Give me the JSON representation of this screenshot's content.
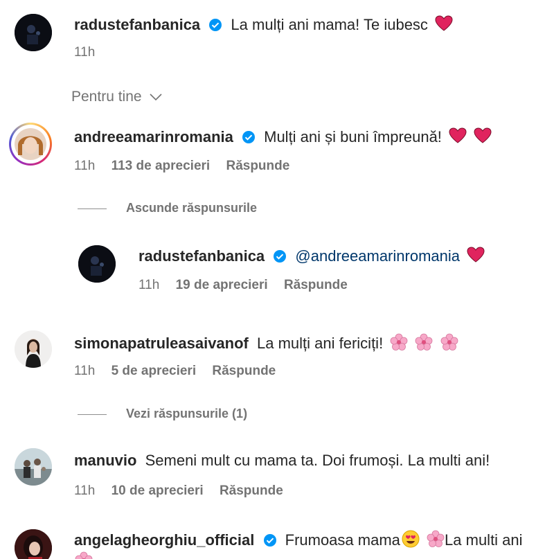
{
  "comments": [
    {
      "username": "radustefanbanica",
      "verified": true,
      "text": "La mulți ani mama! Te iubesc",
      "emoji": [
        "red-heart"
      ],
      "time": "11h"
    }
  ],
  "section_label": "Pentru tine",
  "thread": [
    {
      "username": "andreeamarinromania",
      "verified": true,
      "text": "Mulți ani și buni împreună!",
      "emoji": [
        "red-heart",
        "red-heart"
      ],
      "time": "11h",
      "likes": "113 de aprecieri",
      "reply_label": "Răspunde",
      "toggle": "Ascunde răspunsurile",
      "reply": {
        "username": "radustefanbanica",
        "verified": true,
        "mention": "@andreeamarinromania",
        "emoji": [
          "red-heart"
        ],
        "time": "11h",
        "likes": "19 de aprecieri",
        "reply_label": "Răspunde"
      }
    },
    {
      "username": "simonapatruleasaivanof",
      "verified": false,
      "text": "La mulți ani fericiți!",
      "emoji": [
        "cherry-blossom",
        "cherry-blossom",
        "cherry-blossom"
      ],
      "time": "11h",
      "likes": "5 de aprecieri",
      "reply_label": "Răspunde",
      "toggle": "Vezi răspunsurile (1)"
    },
    {
      "username": "manuvio",
      "verified": false,
      "text": "Semeni mult cu mama ta. Doi frumoși. La multi ani!",
      "time": "11h",
      "likes": "10 de aprecieri",
      "reply_label": "Răspunde"
    },
    {
      "username": "angelagheorghiu_official",
      "verified": true,
      "text_a": "Frumoasa mama",
      "text_b": "La multi ani",
      "emoji": [
        "heart-eyes-face",
        "cherry-blossom"
      ]
    }
  ],
  "colors": {
    "verified_blue": "#0095f6",
    "heart_red": "#e0245e",
    "meta_gray": "#737373",
    "mention_blue": "#00376b"
  }
}
